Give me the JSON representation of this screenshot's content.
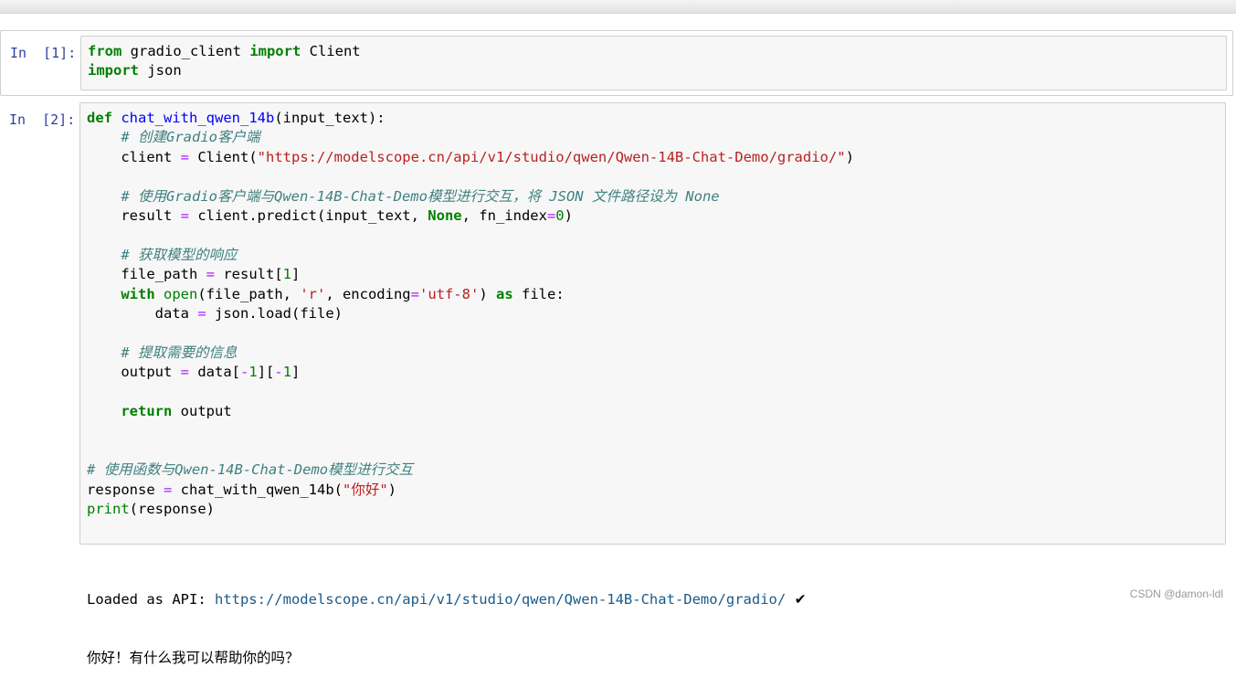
{
  "cells": [
    {
      "prompt": "In  [1]:",
      "lines": [
        "from gradio_client import Client",
        "import json"
      ]
    },
    {
      "prompt": "In  [2]:",
      "lines": [
        "def chat_with_qwen_14b(input_text):",
        "    # 创建Gradio客户端",
        "    client = Client(\"https://modelscope.cn/api/v1/studio/qwen/Qwen-14B-Chat-Demo/gradio/\")",
        "",
        "    # 使用Gradio客户端与Qwen-14B-Chat-Demo模型进行交互，将 JSON 文件路径设为 None",
        "    result = client.predict(input_text, None, fn_index=0)",
        "",
        "    # 获取模型的响应",
        "    file_path = result[1]",
        "    with open(file_path, 'r', encoding='utf-8') as file:",
        "        data = json.load(file)",
        "",
        "    # 提取需要的信息",
        "    output = data[-1][-1]",
        "",
        "    return output",
        "",
        "",
        "# 使用函数与Qwen-14B-Chat-Demo模型进行交互",
        "response = chat_with_qwen_14b(\"你好\")",
        "print(response)"
      ],
      "output": {
        "loaded_prefix": "Loaded as API: ",
        "loaded_url": "https://modelscope.cn/api/v1/studio/qwen/Qwen-14B-Chat-Demo/gradio/",
        "check": "✔",
        "response": "你好！有什么我可以帮助你的吗？"
      }
    }
  ],
  "watermark": "CSDN @damon-ldl"
}
